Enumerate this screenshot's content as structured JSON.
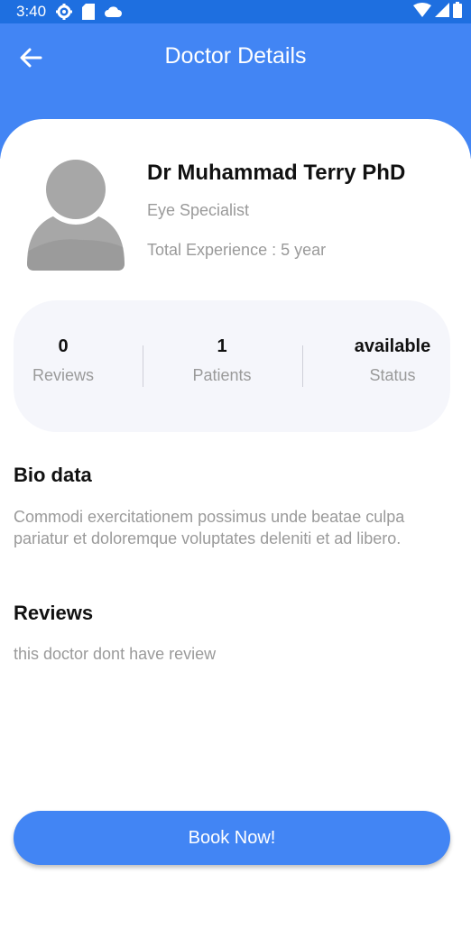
{
  "status_bar": {
    "time": "3:40",
    "icons": [
      "settings-icon",
      "sd-card-icon",
      "cloud-icon",
      "wifi-icon",
      "signal-icon",
      "battery-icon"
    ]
  },
  "app_bar": {
    "title": "Doctor Details",
    "back_icon": "arrow-left-icon"
  },
  "doctor": {
    "name": "Dr Muhammad Terry PhD",
    "specialty": "Eye Specialist",
    "experience": "Total Experience : 5 year",
    "avatar_icon": "person-placeholder-icon"
  },
  "stats": [
    {
      "value": "0",
      "label": "Reviews"
    },
    {
      "value": "1",
      "label": "Patients"
    },
    {
      "value": "available",
      "label": "Status"
    }
  ],
  "bio": {
    "title": "Bio data",
    "text": "Commodi exercitationem possimus unde beatae culpa pariatur et doloremque voluptates deleniti et ad libero."
  },
  "reviews": {
    "title": "Reviews",
    "empty_text": "this doctor dont have review"
  },
  "book_button": {
    "label": "Book Now!"
  },
  "colors": {
    "primary": "#4285f4",
    "status_bar": "#1e6fe0",
    "stats_bg": "#f5f6fb",
    "muted_text": "#9a9a9a"
  }
}
